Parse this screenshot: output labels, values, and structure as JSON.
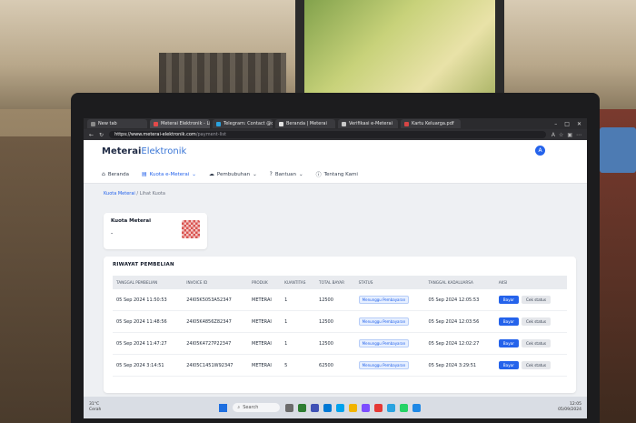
{
  "browser": {
    "tabs": [
      {
        "label": "New tab",
        "color": "#8a8a8a"
      },
      {
        "label": "Meterai Elektronik - Liha",
        "color": "#e24a4a",
        "active": true
      },
      {
        "label": "Telegram: Contact @cl",
        "color": "#2aa3e0"
      },
      {
        "label": "Beranda | Meterai",
        "color": "#e2e2e2"
      },
      {
        "label": "Verifikasi e-Meterai",
        "color": "#c9c9c9"
      },
      {
        "label": "Kartu Keluarga.pdf",
        "color": "#d64545"
      }
    ],
    "url_host": "https://www.meterai-elektronik.com",
    "url_path": "/payment-list"
  },
  "app": {
    "brand_bold": "Meterai",
    "brand_light": "Elektronik",
    "avatar": "A",
    "menu": [
      "Beranda",
      "Kuota e-Meterai",
      "Pembubuhan",
      "Bantuan",
      "Tentang Kami"
    ],
    "breadcrumb": {
      "link": "Kuota Meterai",
      "current": "Lihat Kuota"
    },
    "quota": {
      "title": "Kuota Meterai",
      "value": "-"
    },
    "history": {
      "title": "RIWAYAT PEMBELIAN",
      "columns": [
        "Tanggal Pembelian",
        "Invoice ID",
        "Produk",
        "Kuantitas",
        "Total Bayar",
        "Status",
        "Tanggal Kadaluarsa",
        "Aksi"
      ],
      "rows": [
        {
          "date": "05 Sep 2024 11:50:53",
          "invoice": "24I05K5053A52347",
          "product": "METERAI",
          "qty": "1",
          "total": "12500",
          "status": "Menunggu Pembayaran",
          "expiry": "05 Sep 2024 12:05:53"
        },
        {
          "date": "05 Sep 2024 11:48:56",
          "invoice": "24I05K4856Z82347",
          "product": "METERAI",
          "qty": "1",
          "total": "12500",
          "status": "Menunggu Pembayaran",
          "expiry": "05 Sep 2024 12:03:56"
        },
        {
          "date": "05 Sep 2024 11:47:27",
          "invoice": "24I05K4727P22347",
          "product": "METERAI",
          "qty": "1",
          "total": "12500",
          "status": "Menunggu Pembayaran",
          "expiry": "05 Sep 2024 12:02:27"
        },
        {
          "date": "05 Sep 2024 3:14:51",
          "invoice": "24I05C1451W92347",
          "product": "METERAI",
          "qty": "5",
          "total": "62500",
          "status": "Menunggu Pembayaran",
          "expiry": "05 Sep 2024 3:29:51"
        }
      ],
      "pay_label": "Bayar",
      "check_label": "Cek status"
    }
  },
  "taskbar": {
    "weather_temp": "31°C",
    "weather_desc": "Cerah",
    "search": "Search",
    "icons": [
      "#6b6b6b",
      "#2e7d32",
      "#3f51b5",
      "#0078d4",
      "#00a2ed",
      "#f2b400",
      "#7c4dff",
      "#e53935",
      "#2aa3e0",
      "#25d366",
      "#1e88e5"
    ],
    "time": "12:05",
    "date": "05/09/2024"
  }
}
